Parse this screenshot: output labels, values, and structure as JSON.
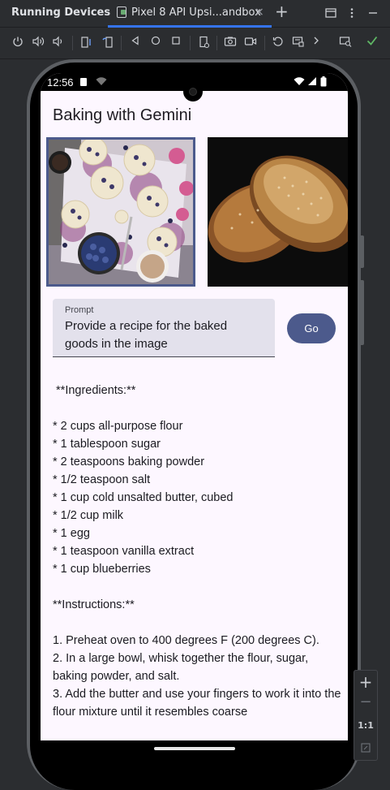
{
  "ide": {
    "panel_title": "Running Devices",
    "tab_label": "Pixel 8 API Upsi...andbox",
    "tab_close": "×",
    "new_tab": "+"
  },
  "toolbar": {
    "icons": [
      "power-icon",
      "volume-up-icon",
      "volume-down-icon",
      "rotate-left-icon",
      "rotate-right-icon",
      "back-icon",
      "home-icon",
      "overview-icon",
      "device-posture-icon",
      "screenshot-icon",
      "screen-record-icon",
      "snapshot-icon",
      "device-controls-icon",
      "more-icon",
      "device-explorer-icon",
      "check-icon"
    ]
  },
  "status_bar": {
    "time": "12:56"
  },
  "app": {
    "title": "Baking with Gemini",
    "prompt_label": "Prompt",
    "prompt_value": "Provide a recipe for the baked goods in the image",
    "go_label": "Go",
    "output": " **Ingredients:**\n\n* 2 cups all-purpose flour\n* 1 tablespoon sugar\n* 2 teaspoons baking powder\n* 1/2 teaspoon salt\n* 1 cup cold unsalted butter, cubed\n* 1/2 cup milk\n* 1 egg\n* 1 teaspoon vanilla extract\n* 1 cup blueberries\n\n**Instructions:**\n\n1. Preheat oven to 400 degrees F (200 degrees C).\n2. In a large bowl, whisk together the flour, sugar, baking powder, and salt.\n3. Add the butter and use your fingers to work it into the flour mixture until it resembles coarse"
  },
  "zoom": {
    "zoom_in": "+",
    "zoom_out": "−",
    "actual_size": "1:1"
  },
  "colors": {
    "accent": "#4c5a8c",
    "ide_bg": "#2b2d30",
    "app_bg": "#fdf7ff",
    "field_bg": "#e3e1ec"
  }
}
